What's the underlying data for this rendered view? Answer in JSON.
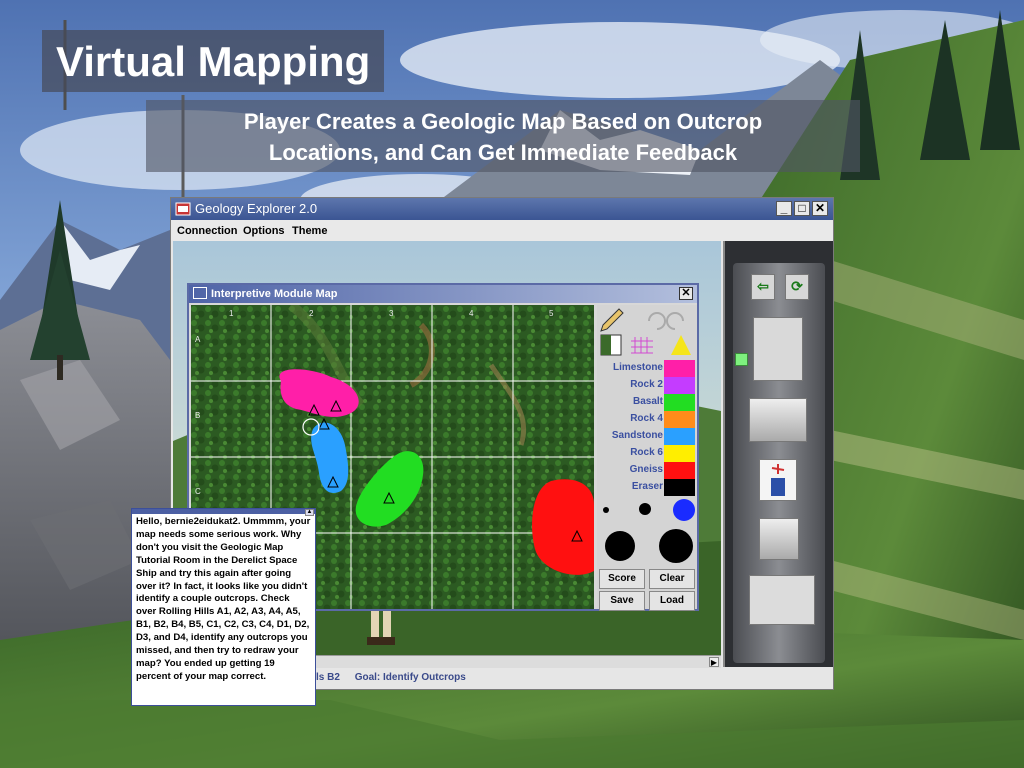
{
  "slide": {
    "title": "Virtual Mapping",
    "subtitle_line1": "Player Creates a Geologic Map Based on Outcrop",
    "subtitle_line2": "Locations, and Can Get Immediate Feedback"
  },
  "app": {
    "window_title": "Geology Explorer 2.0",
    "menu": [
      "Connection",
      "Options",
      "Theme"
    ],
    "window_buttons": {
      "minimize": "_",
      "maximize": "□",
      "close": "✕"
    },
    "status": {
      "location": "ls B2",
      "goal": "Goal: Identify Outcrops"
    }
  },
  "map_window": {
    "title": "Interpretive Module Map",
    "close": "✕",
    "columns": [
      "1",
      "2",
      "3",
      "4",
      "5"
    ],
    "rows": [
      "A",
      "B",
      "C"
    ],
    "legend": [
      {
        "label": "Limestone",
        "color": "#ff1fa8"
      },
      {
        "label": "Rock 2",
        "color": "#c43cff"
      },
      {
        "label": "Basalt",
        "color": "#22dd22"
      },
      {
        "label": "Rock 4",
        "color": "#ff8c1a"
      },
      {
        "label": "Sandstone",
        "color": "#2aa0ff"
      },
      {
        "label": "Rock 6",
        "color": "#ffee00"
      },
      {
        "label": "Gneiss",
        "color": "#ff1010"
      },
      {
        "label": "Eraser",
        "color": "#000000"
      }
    ],
    "buttons": {
      "score": "Score",
      "clear": "Clear",
      "save": "Save",
      "load": "Load"
    }
  },
  "chat": {
    "message": "Hello, bernie2eidukat2. Ummmm, your map needs some serious work. Why don't you visit the Geologic Map Tutorial Room in the Derelict Space Ship and try this again after going over it? In fact, it looks like you didn't identify a couple outcrops. Check over Rolling Hills A1, A2, A3, A4, A5, B1, B2, B4, B5, C1, C2, C3, C4, D1, D2, D3, and D4, identify any outcrops you missed, and then try to redraw your map? You ended up getting 19 percent of your map correct.",
    "score_percent": 19
  },
  "icons": {
    "pencil": "pencil-icon",
    "undo": "undo-icon",
    "redo": "redo-icon",
    "pattern_a": "hatch-pattern-icon",
    "pattern_b": "grid-pattern-icon",
    "triangle": "outcrop-triangle-icon",
    "exit": "exit-icon",
    "refresh": "refresh-icon"
  }
}
